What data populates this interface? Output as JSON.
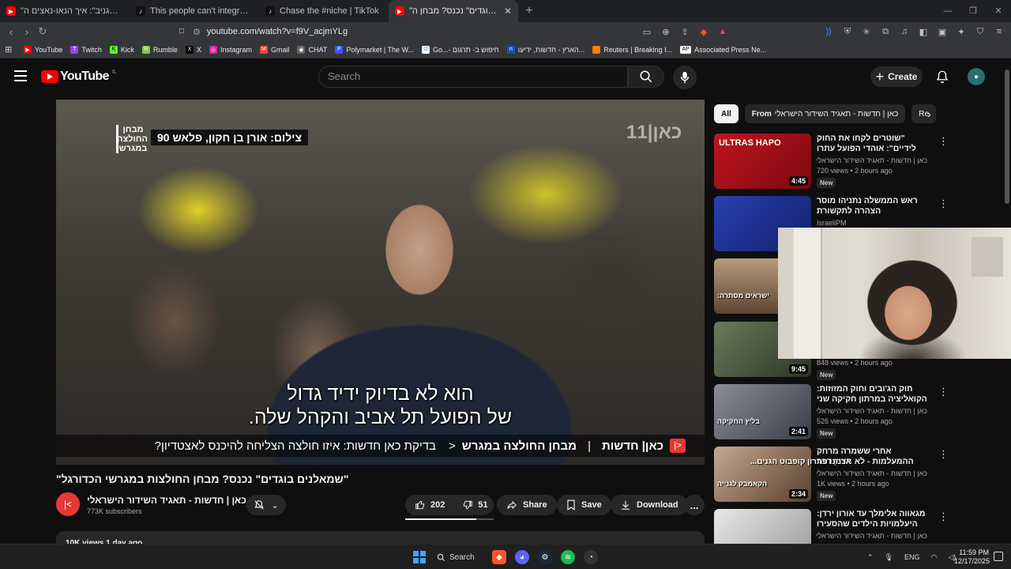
{
  "browser": {
    "tabs": [
      {
        "title": "\"היטלר היה מגניב\": איך הנאו-נאצים ה",
        "icon": "youtube",
        "color": "#ff0000",
        "active": false
      },
      {
        "title": "This people can't integrate into the w",
        "icon": "tiktok",
        "color": "#111111",
        "active": false
      },
      {
        "title": "Chase the #niche | TikTok",
        "icon": "tiktok",
        "color": "#111111",
        "active": false
      },
      {
        "title": "\"שמאלנים בוגדים\" נכנס? מבחן ה",
        "icon": "youtube",
        "color": "#ff0000",
        "active": true
      }
    ],
    "url": "youtube.com/watch?v=f9V_acjmYLg",
    "bookmarks": [
      {
        "label": "YouTube",
        "color": "#ff0000",
        "glyph": "▶"
      },
      {
        "label": "Twitch",
        "color": "#9146ff",
        "glyph": "T"
      },
      {
        "label": "Kick",
        "color": "#53fc18",
        "glyph": "K"
      },
      {
        "label": "Rumble",
        "color": "#85c742",
        "glyph": "R"
      },
      {
        "label": "X",
        "color": "#000000",
        "glyph": "X"
      },
      {
        "label": "Instagram",
        "color": "#d6249f",
        "glyph": "◎"
      },
      {
        "label": "Gmail",
        "color": "#ea4335",
        "glyph": "M"
      },
      {
        "label": "CHAT",
        "color": "#666666",
        "glyph": "◉"
      },
      {
        "label": "Polymarket | The W...",
        "color": "#2d5bff",
        "glyph": "P"
      },
      {
        "label": "Go...- חיפוש ב- תרגום",
        "color": "#ffffff",
        "glyph": "G"
      },
      {
        "label": "הארץ - חדשות, ידיעו...",
        "color": "#1f4fbf",
        "glyph": "ה"
      },
      {
        "label": "Reuters | Breaking I...",
        "color": "#ff7a00",
        "glyph": "◌"
      },
      {
        "label": "Associated Press Ne...",
        "color": "#ffffff",
        "glyph": "AP"
      }
    ]
  },
  "youtube": {
    "logo_text": "YouTube",
    "country_code": "IL",
    "search_placeholder": "Search",
    "create_label": "Create"
  },
  "player": {
    "credit": "צילום: אורן בן חקון, פלאש 90",
    "brand": "מבחן החולצה במגרש",
    "channel_logo": "כאן|11",
    "subtitle_line1": "הוא לא בדיוק ידיד גדול",
    "subtitle_line2": "של הפועל תל אביב והקהל שלה.",
    "ticker_brand": "כאן| חדשות",
    "ticker_sep": "|",
    "ticker_segment": "מבחן החולצה במגרש",
    "ticker_chevron": "<",
    "ticker_text": "בדיקת כאן חדשות: איזו חולצה הצליחה להיכנס לאצטדיון?"
  },
  "video": {
    "title": "\"שמאלנים בוגדים\" נכנס? מבחן החולצות במגרשי הכדורגל\"",
    "channel": "כאן | חדשות - תאגיד השידור הישראלי",
    "subscribers": "773K subscribers",
    "likes": "202",
    "dislikes": "51",
    "share": "Share",
    "save": "Save",
    "download": "Download",
    "more": "...",
    "description_preview": "10K views  1 day ago",
    "like_ratio": 0.8
  },
  "sidebar": {
    "chips": [
      {
        "label": "All",
        "active": true
      },
      {
        "prefix": "From",
        "label": "כאן | חדשות - תאגיד השידור הישראלי",
        "active": false
      },
      {
        "label": "Re",
        "active": false
      }
    ],
    "recommendations": [
      {
        "title": "\"שוטרים לקחו את החוק לידיים\": אוהדי הפועל עתרו לבג\"ץ נגד ...",
        "channel": "כאן | חדשות - תאגיד השידור הישראלי",
        "meta": "720 views • 2 hours ago",
        "badge": "New",
        "duration": "4:45",
        "thumb_label": "ULTRAS HAPO",
        "thumb_color": "#b3121b"
      },
      {
        "title": "ראש הממשלה נתניהו מוסר הצהרה לתקשורת",
        "channel": "IsraeliPM",
        "meta": "",
        "badge": "",
        "duration": "",
        "thumb_label": "",
        "thumb_color": "#1d2f8c"
      },
      {
        "title": "",
        "channel": "",
        "meta": "",
        "badge": "",
        "duration": "",
        "thumb_label": "ישראים מסתרה:",
        "thumb_color": "#8a6a4c"
      },
      {
        "title": "",
        "channel": "",
        "meta": "848 views • 2 hours ago",
        "badge": "New",
        "duration": "9:45",
        "thumb_label": "",
        "thumb_color": "#3c4a3c"
      },
      {
        "title": "חוק הג'ובים וחוק המזוזות: הקואליציה במרתון חקיקה שני במחקוקת",
        "channel": "כאן | חדשות - תאגיד השידור הישראלי",
        "meta": "526 views • 2 hours ago",
        "badge": "New",
        "duration": "2:41",
        "thumb_label": "בליץ החקיקה",
        "thumb_color": "#4a4a52"
      },
      {
        "title": "אחרי ששמרה מרחק ההמעלמות - לא תציון דבר",
        "channel": "כאן | חדשות - תאגיד השידור הישראלי",
        "meta": "1K views • 2 hours ago",
        "badge": "New",
        "duration": "2:34",
        "thumb_label": "הקאמבק לגנייה",
        "thumb_color": "#6b5848"
      },
      {
        "title": "מגאווה אלימלך עד אורון ירדן: היעלמויות הילדים שהסעירו את ...",
        "channel": "כאן | חדשות - תאגיד השידור הישראלי",
        "meta": "",
        "badge": "",
        "duration": "",
        "thumb_label": "",
        "thumb_color": "#cccccc"
      }
    ],
    "overlay_text": "ארנונו פתרון קופבוט הגנים..."
  },
  "taskbar": {
    "search_label": "Search",
    "language": "ENG",
    "time": "11:59 PM",
    "date": "12/17/2025"
  }
}
